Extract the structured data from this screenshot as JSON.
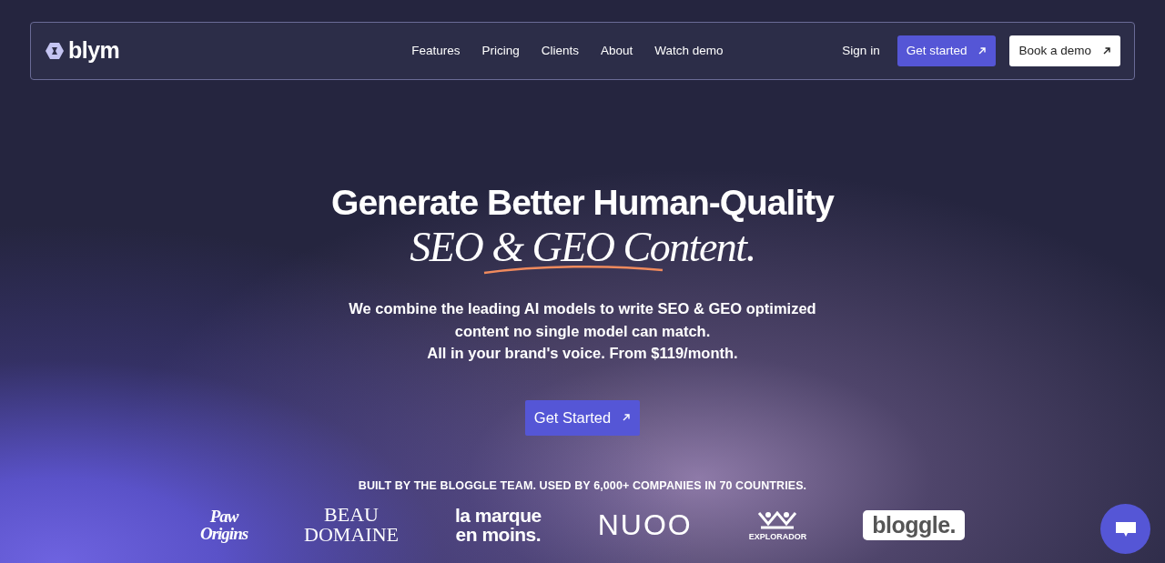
{
  "brand": {
    "name": "blym"
  },
  "nav": {
    "links": [
      "Features",
      "Pricing",
      "Clients",
      "About",
      "Watch demo"
    ],
    "sign_in": "Sign in",
    "buttons": [
      {
        "label": "Get started",
        "kind": "primary"
      },
      {
        "label": "Book a demo",
        "kind": "light"
      }
    ]
  },
  "hero": {
    "headline": "Generate Better Human-Quality",
    "headline_italic": "SEO & GEO Content.",
    "lines": [
      "We combine the leading AI models to write SEO & GEO optimized",
      "content no single model can match.",
      "All in your brand's voice. From $119/month."
    ],
    "cta": "Get Started"
  },
  "clients": {
    "tagline": "BUILT BY THE BLOGGLE TEAM. USED BY 6,000+ COMPANIES IN 70 COUNTRIES.",
    "logos": [
      {
        "kind": "script",
        "lines": [
          "Paw",
          "Origins"
        ]
      },
      {
        "kind": "serif",
        "lines": [
          "BEAU",
          "DOMAINE"
        ]
      },
      {
        "kind": "bold",
        "lines": [
          "la marque",
          "en moins."
        ]
      },
      {
        "kind": "thin",
        "lines": [
          "NUOO"
        ]
      },
      {
        "kind": "emblem",
        "lines": [
          "EXPLORADOR"
        ]
      },
      {
        "kind": "pill",
        "lines": [
          "bloggle."
        ]
      }
    ]
  }
}
